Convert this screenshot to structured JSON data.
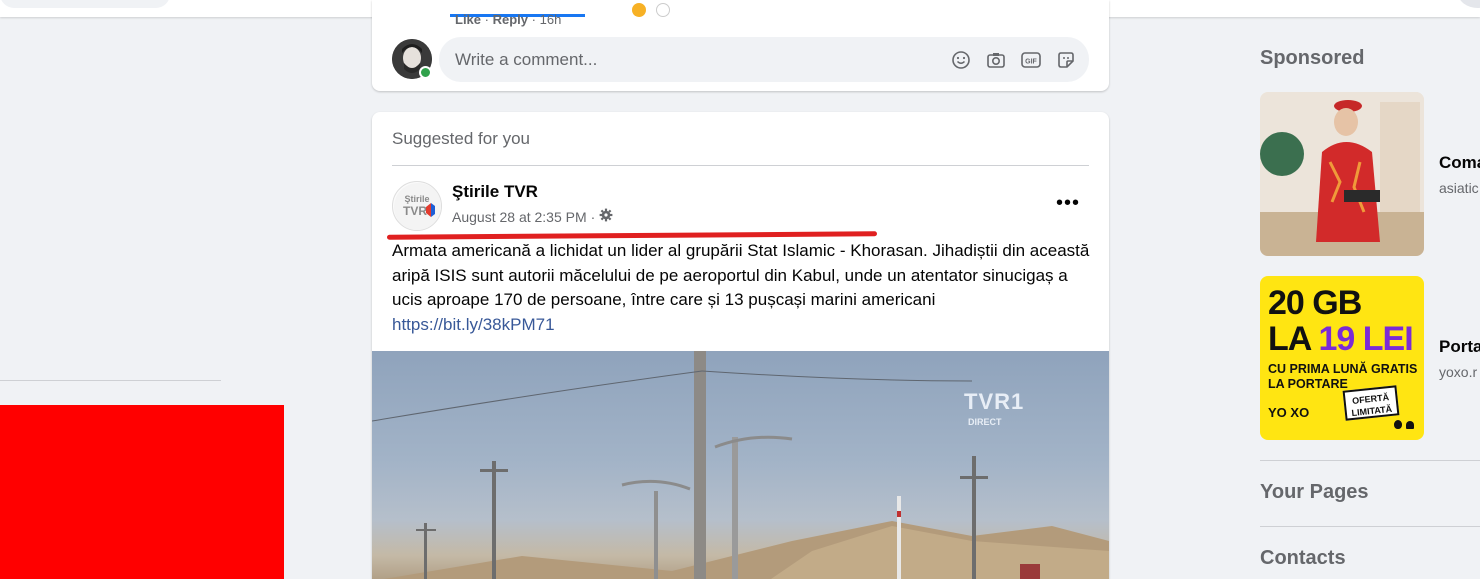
{
  "previous_post": {
    "like_label": "Like",
    "separator": "·",
    "reply_label": "Reply",
    "time": "16h",
    "comment_placeholder": "Write a comment..."
  },
  "post": {
    "section_label": "Suggested for you",
    "page_name": "Ştirile TVR",
    "timestamp": "August 28 at 2:35 PM",
    "meta_separator": "·",
    "more_label": "•••",
    "body": "Armata americană a lichidat un lider al grupării Stat Islamic - Khorasan. Jihadiștii din această aripă ISIS sunt autorii măcelului de pe aeroportul din Kabul, unde un atentator sinucigaș a ucis aproape 170 de persoane, între care și 13 pușcași marini americani ",
    "link": "https://bit.ly/38kPM71",
    "logo_text_top": "Ştirile",
    "logo_text_bottom": "TVR",
    "image_watermark": "TVR1",
    "image_watermark_sub": "DIRECT"
  },
  "sidebar": {
    "sponsored_title": "Sponsored",
    "ads": [
      {
        "title": "Coma",
        "domain": "asiatic"
      },
      {
        "title": "Porta",
        "domain": "yoxo.r"
      }
    ],
    "ad2_creative": {
      "line1": "20 GB",
      "line2_prefix": "LA ",
      "line2_highlight": "19 LEI",
      "line3": "CU PRIMA LUNĂ GRATIS",
      "line4": "LA PORTARE",
      "badge": "OFERTĂ LIMITATĂ",
      "logo": "YO XO"
    },
    "your_pages_title": "Your Pages",
    "contacts_title": "Contacts"
  },
  "colors": {
    "background": "#f0f2f5",
    "card": "#ffffff",
    "link": "#385898",
    "annotation_red": "#e02020",
    "red_block": "#ff0000",
    "ad_yellow": "#ffe512",
    "online_green": "#31a24c"
  }
}
